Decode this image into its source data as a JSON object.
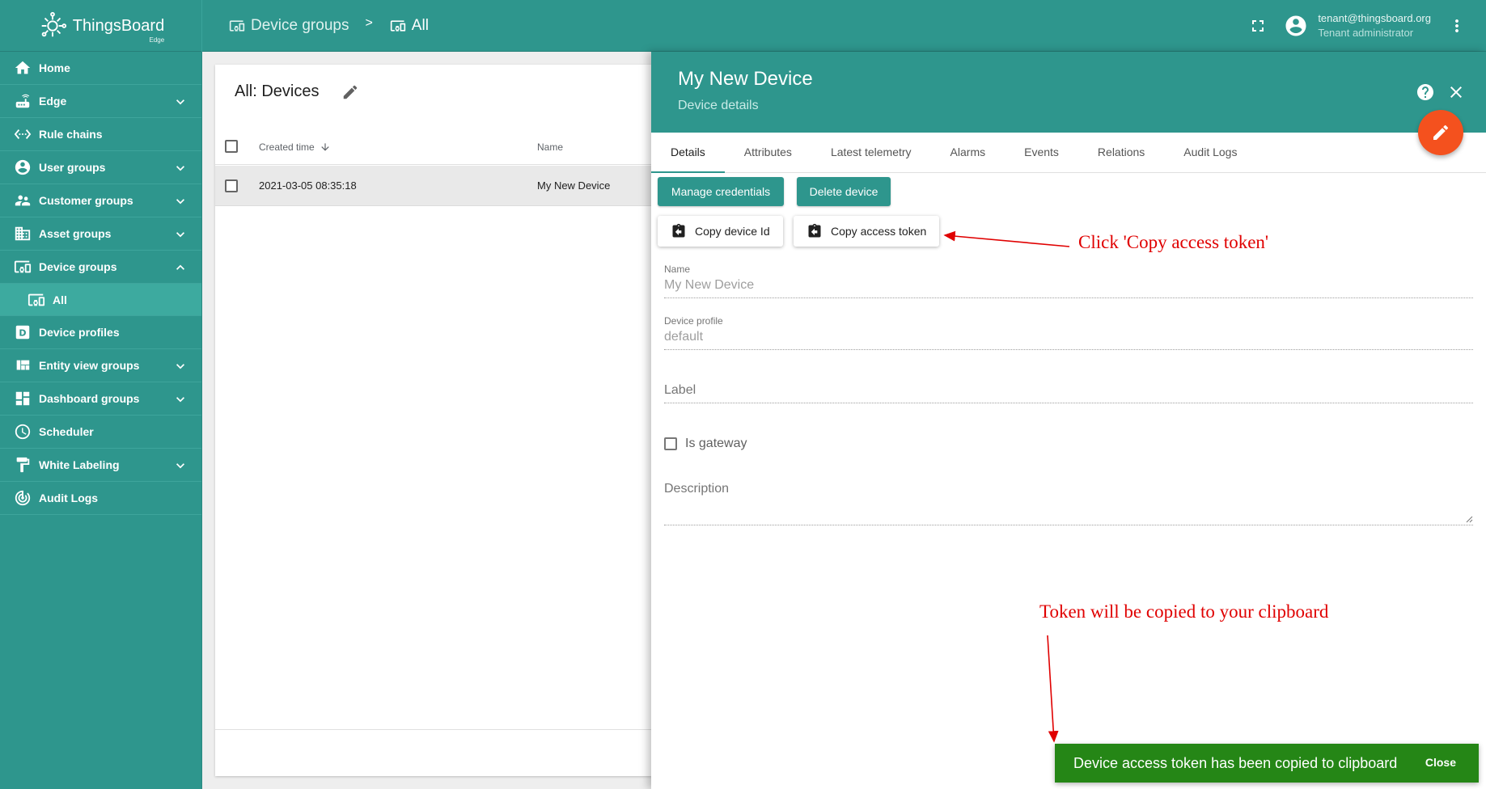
{
  "app": {
    "name": "ThingsBoard",
    "edition": "Edge"
  },
  "breadcrumb": {
    "parent": "Device groups",
    "separator": ">",
    "current": "All"
  },
  "user": {
    "email": "tenant@thingsboard.org",
    "role": "Tenant administrator"
  },
  "sidebar": {
    "items": [
      {
        "label": "Home",
        "icon": "home-icon"
      },
      {
        "label": "Edge",
        "icon": "router-icon",
        "expandable": true
      },
      {
        "label": "Rule chains",
        "icon": "settings-ethernet-icon"
      },
      {
        "label": "User groups",
        "icon": "account-circle-icon",
        "expandable": true
      },
      {
        "label": "Customer groups",
        "icon": "supervisor-account-icon",
        "expandable": true
      },
      {
        "label": "Asset groups",
        "icon": "domain-icon",
        "expandable": true
      },
      {
        "label": "Device groups",
        "icon": "devices-other-icon",
        "expandable": true,
        "expanded": true
      },
      {
        "label": "All",
        "icon": "devices-other-icon",
        "sub": true
      },
      {
        "label": "Device profiles",
        "icon": "device-profile-icon"
      },
      {
        "label": "Entity view groups",
        "icon": "view-quilt-icon",
        "expandable": true
      },
      {
        "label": "Dashboard groups",
        "icon": "dashboard-icon",
        "expandable": true
      },
      {
        "label": "Scheduler",
        "icon": "schedule-icon"
      },
      {
        "label": "White Labeling",
        "icon": "format-paint-icon",
        "expandable": true
      },
      {
        "label": "Audit Logs",
        "icon": "track-changes-icon"
      }
    ]
  },
  "list": {
    "title": "All: Devices",
    "columns": {
      "created": "Created time",
      "name": "Name"
    },
    "rows": [
      {
        "created": "2021-03-05 08:35:18",
        "name": "My New Device"
      }
    ]
  },
  "details": {
    "title": "My New Device",
    "subtitle": "Device details",
    "tabs": [
      "Details",
      "Attributes",
      "Latest telemetry",
      "Alarms",
      "Events",
      "Relations",
      "Audit Logs"
    ],
    "active_tab": "Details",
    "buttons": {
      "manage_credentials": "Manage credentials",
      "delete_device": "Delete device",
      "copy_device_id": "Copy device Id",
      "copy_access_token": "Copy access token"
    },
    "fields": {
      "name_label": "Name",
      "name_value": "My New Device",
      "profile_label": "Device profile",
      "profile_value": "default",
      "label_placeholder": "Label",
      "gateway_label": "Is gateway",
      "description_placeholder": "Description"
    }
  },
  "annotations": {
    "click_note": "Click 'Copy access token'",
    "clipboard_note": "Token will be copied to your clipboard",
    "color": "#e00000"
  },
  "snackbar": {
    "message": "Device access token has been copied to clipboard",
    "close": "Close",
    "color": "#258616"
  },
  "colors": {
    "primary": "#2e968d",
    "accent": "#f4511e"
  }
}
